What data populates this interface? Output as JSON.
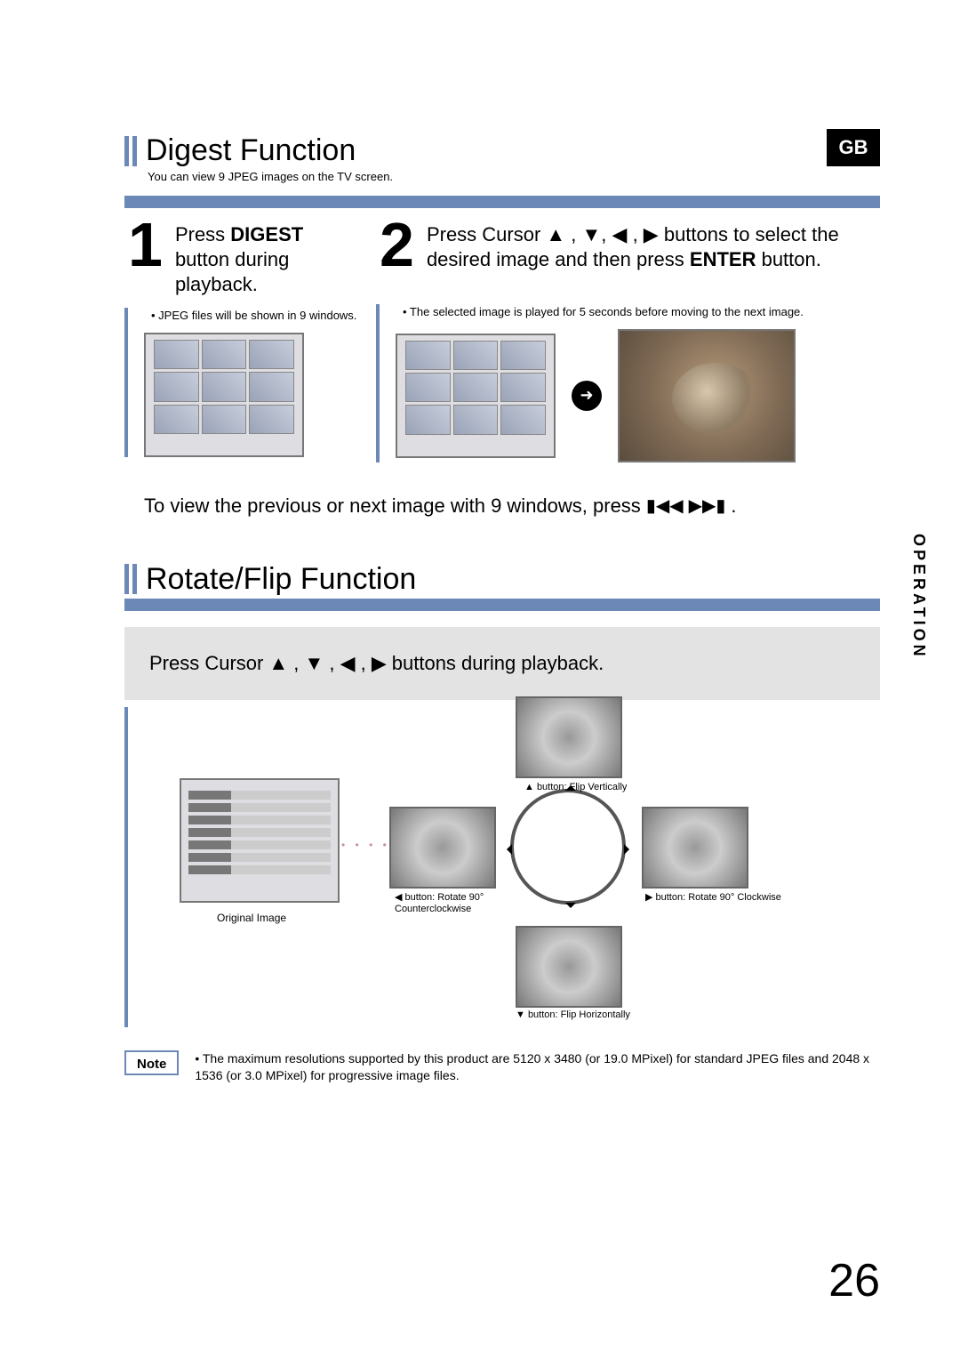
{
  "gb": "GB",
  "sidebar": "OPERATION",
  "page_number": "26",
  "digest": {
    "title": "Digest Function",
    "subcaption": "You can view 9 JPEG images on the TV screen.",
    "step1": {
      "num": "1",
      "text_before_bold": "Press ",
      "bold1": "DIGEST",
      "text_after": " button during playback.",
      "bullet": "• JPEG files will be shown in 9 windows."
    },
    "step2": {
      "num": "2",
      "text_a": "Press Cursor ",
      "text_b": " buttons to select the desired image and then press ",
      "bold_enter": "ENTER",
      "text_c": " button.",
      "bullet": "• The selected image is played for 5 seconds before moving to the next image."
    },
    "between": {
      "a": "To view the previous or next image with 9 windows, press ",
      "b": "."
    }
  },
  "rotate": {
    "title": "Rotate/Flip Function",
    "band_a": "Press Cursor ",
    "band_b": " buttons during playback.",
    "orig_caption": "Original Image",
    "cap_up": "▲ button: Flip Vertically",
    "cap_down": "▼ button: Flip Horizontally",
    "cap_left_a": "◀ button: Rotate 90°",
    "cap_left_b": "Counterclockwise",
    "cap_right": "▶ button: Rotate 90° Clockwise"
  },
  "note": {
    "label": "Note",
    "text": "• The maximum resolutions supported by this product are 5120 x 3480 (or 19.0 MPixel) for standard JPEG files and 2048 x 1536 (or 3.0 MPixel) for progressive image files."
  }
}
